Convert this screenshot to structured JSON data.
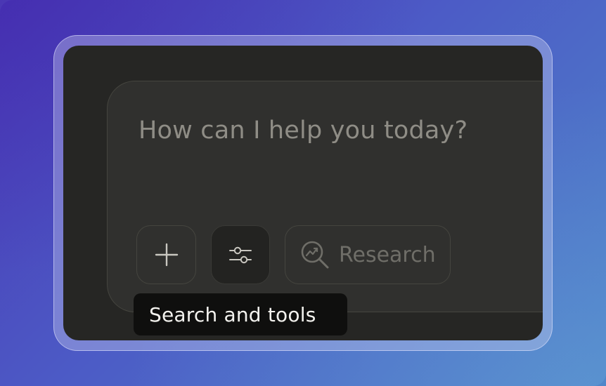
{
  "composer": {
    "placeholder": "How can I help you today?"
  },
  "toolbar": {
    "add_icon": "plus-icon",
    "tools_icon": "sliders-icon",
    "research_icon": "research-trend-magnifier-icon",
    "research_label": "Research"
  },
  "tooltip": {
    "text": "Search and tools"
  },
  "colors": {
    "window_bg": "#262624",
    "composer_bg": "#30302e",
    "tooltip_bg": "#0f0f0e",
    "placeholder_text": "#8f8d86"
  }
}
